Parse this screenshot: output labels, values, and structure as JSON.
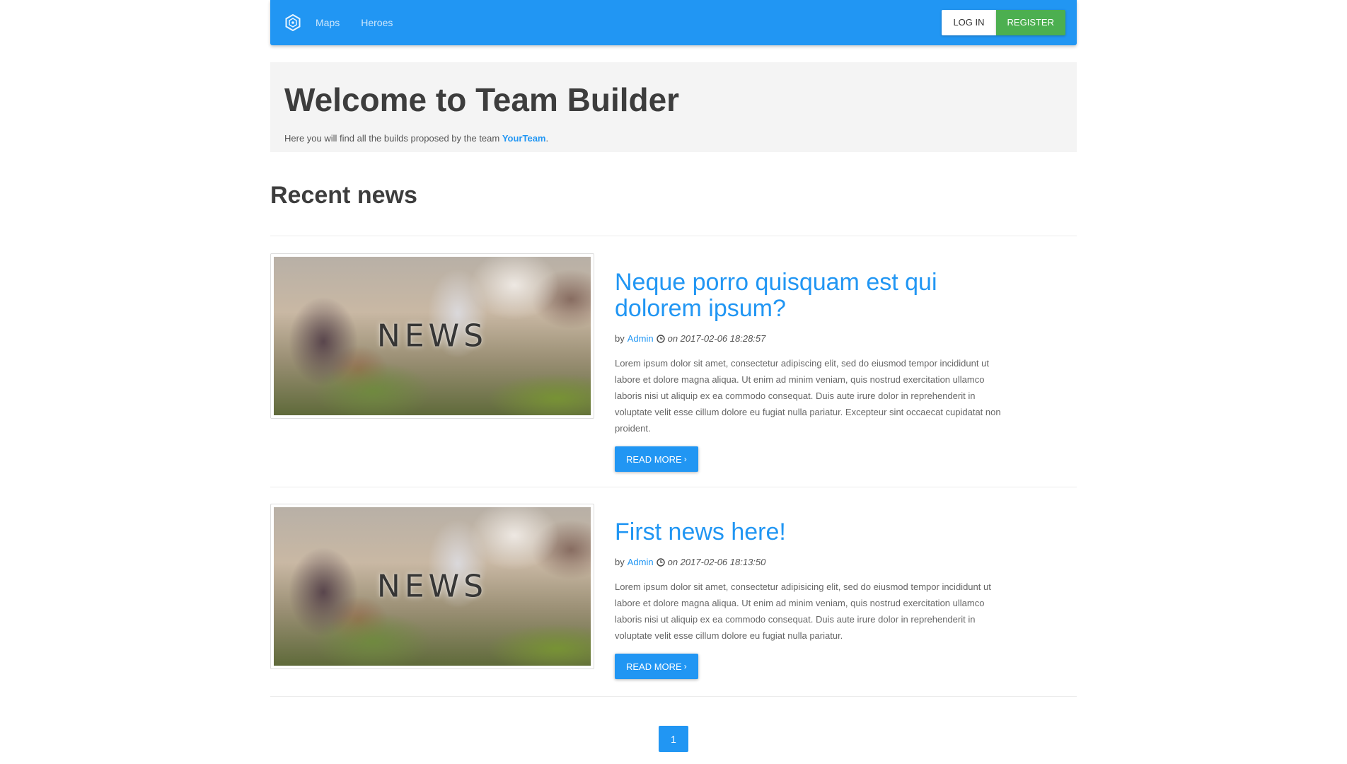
{
  "navbar": {
    "brand_icon": "hexagon-logo-icon",
    "links": [
      "Maps",
      "Heroes"
    ],
    "login_label": "LOG IN",
    "register_label": "REGISTER"
  },
  "jumbotron": {
    "title": "Welcome to Team Builder",
    "text_before": "Here you will find all the builds proposed by the team ",
    "team_link": "YourTeam",
    "text_after": "."
  },
  "recent_news": {
    "title": "Recent news"
  },
  "posts": [
    {
      "thumbnail_text": "NEWS",
      "title": "Neque porro quisquam est qui dolorem ipsum?",
      "by_label": "by",
      "author": "Admin",
      "date": "on 2017-02-06 18:28:57",
      "excerpt": "Lorem ipsum dolor sit amet, consectetur adipiscing elit, sed do eiusmod tempor incididunt ut labore et dolore magna aliqua. Ut enim ad minim veniam, quis nostrud exercitation ullamco laboris nisi ut aliquip ex ea commodo consequat. Duis aute irure dolor in reprehenderit in voluptate velit esse cillum dolore eu fugiat nulla pariatur. Excepteur sint occaecat cupidatat non proident.",
      "read_more_label": "READ MORE"
    },
    {
      "thumbnail_text": "NEWS",
      "title": "First news here!",
      "by_label": "by",
      "author": "Admin",
      "date": "on 2017-02-06 18:13:50",
      "excerpt": "Lorem ipsum dolor sit amet, consectetur adipisicing elit, sed do eiusmod tempor incididunt ut labore et dolore magna aliqua. Ut enim ad minim veniam, quis nostrud exercitation ullamco laboris nisi ut aliquip ex ea commodo consequat. Duis aute irure dolor in reprehenderit in voluptate velit esse cillum dolore eu fugiat nulla pariatur.",
      "read_more_label": "READ MORE"
    }
  ],
  "pagination": {
    "current_page": "1"
  },
  "colors": {
    "primary": "#2196f3",
    "success": "#4caf50",
    "jumbotron_bg": "#f4f4f4",
    "heading": "#3d3d3d"
  }
}
